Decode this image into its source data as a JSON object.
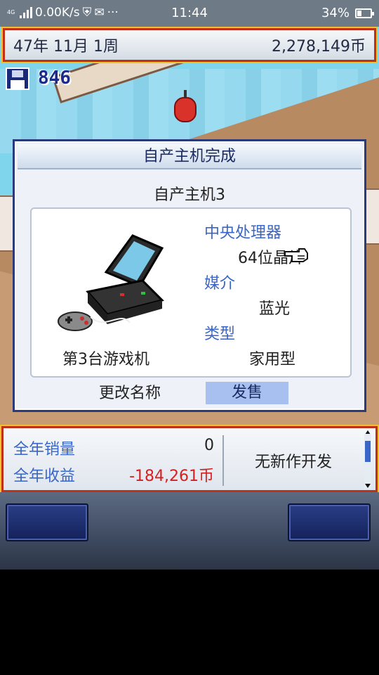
{
  "status_bar": {
    "network_speed": "0.00K/s",
    "network_type": "4G",
    "time": "11:44",
    "battery_percent": "34%",
    "battery_level": 0.34,
    "dots": "···"
  },
  "hud": {
    "date": "47年 11月 1周",
    "money": "2,278,149币",
    "save_count": "846"
  },
  "dialog": {
    "title": "自产主机完成",
    "console_name": "自产主机3",
    "cpu_label": "中央处理器",
    "cpu_value": "64位晶片",
    "media_label": "媒介",
    "media_value": "蓝光",
    "type_label": "类型",
    "type_value": "家用型",
    "console_index": "第3台游戏机",
    "rename_button": "更改名称",
    "sell_button": "发售"
  },
  "info_panel": {
    "annual_sales_label": "全年销量",
    "annual_sales_value": "0",
    "annual_revenue_label": "全年收益",
    "annual_revenue_value": "-184,261币",
    "development_status": "无新作开发"
  },
  "colors": {
    "hud_border": "#c03018",
    "label_blue": "#3a66c8",
    "negative_red": "#d42020",
    "dialog_border": "#2a3a7a"
  }
}
